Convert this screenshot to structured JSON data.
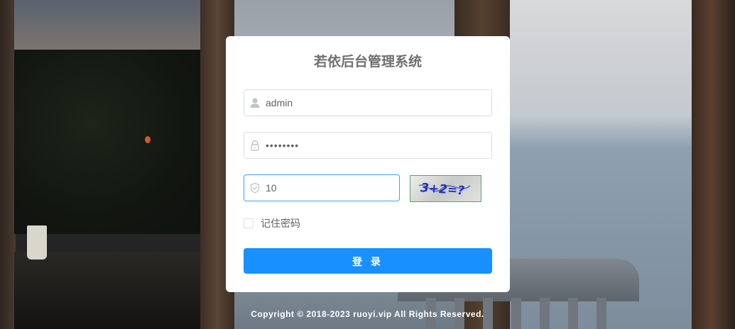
{
  "app": {
    "title": "若依后台管理系统"
  },
  "login_form": {
    "username_value": "admin",
    "password_value": "••••••••",
    "captcha_value": "10",
    "captcha_image_text": "3+2=?",
    "remember_label": "记住密码",
    "remember_checked": false,
    "login_button_label": "登 录"
  },
  "footer": {
    "copyright": "Copyright © 2018-2023 ruoyi.vip All Rights Reserved."
  },
  "icons": {
    "username": "user-icon",
    "password": "lock-icon",
    "captcha": "shield-check-icon"
  },
  "colors": {
    "primary": "#1890ff",
    "focus_border": "#409eff",
    "title_text": "#707070",
    "input_border": "#dcdfe6"
  }
}
